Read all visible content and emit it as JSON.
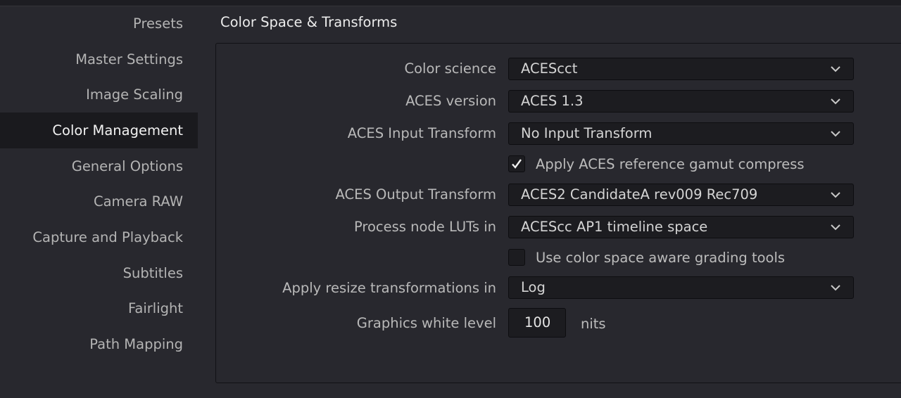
{
  "sidebar": {
    "items": [
      {
        "label": "Presets"
      },
      {
        "label": "Master Settings"
      },
      {
        "label": "Image Scaling"
      },
      {
        "label": "Color Management"
      },
      {
        "label": "General Options"
      },
      {
        "label": "Camera RAW"
      },
      {
        "label": "Capture and Playback"
      },
      {
        "label": "Subtitles"
      },
      {
        "label": "Fairlight"
      },
      {
        "label": "Path Mapping"
      }
    ],
    "active": "Color Management"
  },
  "section": {
    "title": "Color Space & Transforms"
  },
  "settings": {
    "color_science": {
      "label": "Color science",
      "value": "ACEScct"
    },
    "aces_version": {
      "label": "ACES version",
      "value": "ACES 1.3"
    },
    "aces_input_transform": {
      "label": "ACES Input Transform",
      "value": "No Input Transform"
    },
    "gamut_compress": {
      "label": "Apply ACES reference gamut compress",
      "checked": true
    },
    "aces_output_transform": {
      "label": "ACES Output Transform",
      "value": "ACES2 CandidateA rev009 Rec709"
    },
    "process_node_luts": {
      "label": "Process node LUTs in",
      "value": "ACEScc AP1 timeline space"
    },
    "color_space_aware": {
      "label": "Use color space aware grading tools",
      "checked": false
    },
    "resize_transformations": {
      "label": "Apply resize transformations in",
      "value": "Log"
    },
    "graphics_white_level": {
      "label": "Graphics white level",
      "value": "100",
      "unit": "nits"
    }
  },
  "icons": {
    "dropdown": "chevron-down-icon",
    "checkbox": "checkmark-icon"
  },
  "colors": {
    "background": "#28282e",
    "field": "#1c1c20",
    "active_item": "#1a1a1e"
  }
}
